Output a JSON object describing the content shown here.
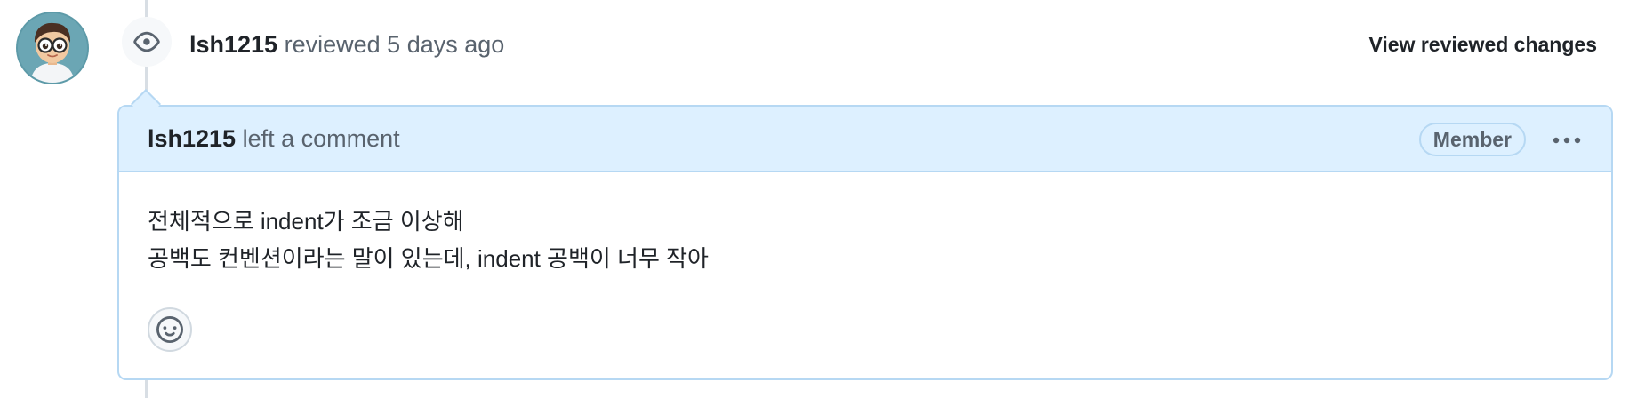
{
  "event": {
    "author": "lsh1215",
    "action": "reviewed",
    "time": "5 days ago",
    "view_changes_label": "View reviewed changes",
    "icon": "eye-icon"
  },
  "comment": {
    "author": "lsh1215",
    "action": "left a comment",
    "role_badge": "Member",
    "more_icon": "kebab-horizontal-icon",
    "body_lines": [
      "전체적으로 indent가 조금 이상해",
      "공백도 컨벤션이라는 말이 있는데, indent 공백이 너무 작아"
    ],
    "reaction_icon": "smiley-icon"
  },
  "colors": {
    "header_bg": "#ddf0ff",
    "border": "#b6d8f3",
    "muted_text": "#59636e",
    "primary_text": "#1f2328"
  }
}
